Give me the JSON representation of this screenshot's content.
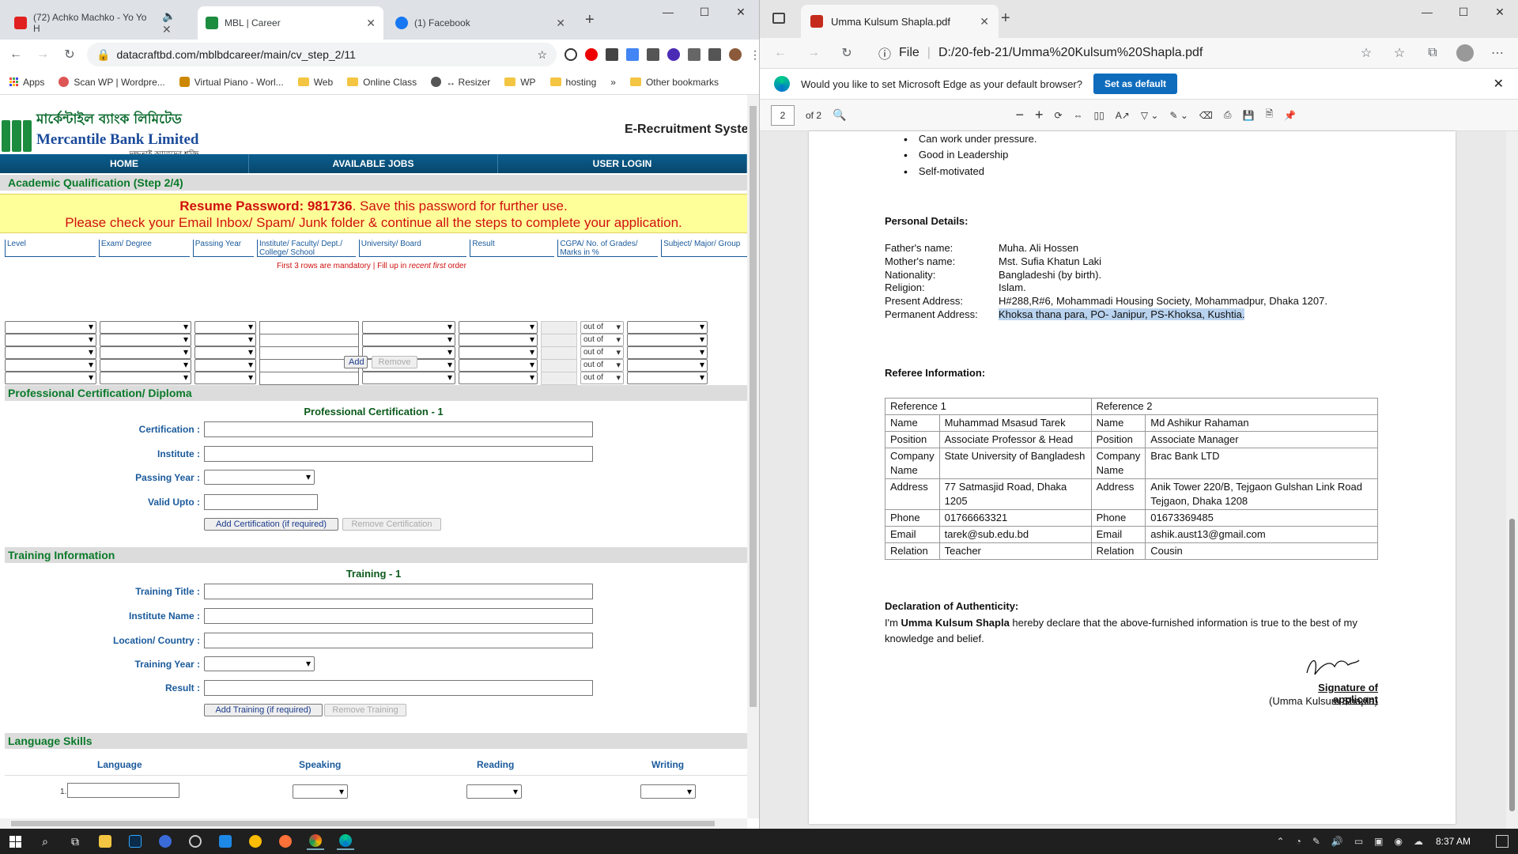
{
  "chrome": {
    "tabs": [
      {
        "title": "(72) Achko Machko - Yo Yo H",
        "color": "#e02020"
      },
      {
        "title": "MBL | Career",
        "color": "#1c8c3f"
      },
      {
        "title": "(1) Facebook",
        "color": "#1877f2"
      }
    ],
    "url": "datacraftbd.com/mblbdcareer/main/cv_step_2/11",
    "bookmarks": [
      "Apps",
      "Scan WP | Wordpre...",
      "Virtual Piano - Worl...",
      "Web",
      "Online Class",
      "↔ Resizer",
      "WP",
      "hosting",
      "»",
      "Other bookmarks"
    ]
  },
  "site": {
    "logo_bn": "মার্কেন্টাইল ব্যাংক লিমিটেড",
    "logo_en": "Mercantile Bank Limited",
    "logo_tag": "দক্ষতাই আমাদের শক্তি",
    "ers": "E-Recruitment Syste",
    "nav": [
      "HOME",
      "AVAILABLE JOBS",
      "USER LOGIN"
    ],
    "academic_header": "Academic Qualification (Step 2/4)",
    "pwd_prefix": "Resume Password: 981736",
    "pwd_suffix": ". Save this password for further use.",
    "pwd_line2": "Please check your Email Inbox/ Spam/ Junk folder & continue all the steps to complete your application.",
    "columns": [
      "Level",
      "Exam/ Degree",
      "Passing Year",
      "Institute/ Faculty/ Dept./ College/ School",
      "University/ Board",
      "Result",
      "CGPA/ No. of Grades/ Marks in %",
      "Subject/ Major/ Group"
    ],
    "note_a": "First 3 rows are mandatory | Fill up in ",
    "note_b": "recent first",
    "note_c": " order",
    "out_of": "out of",
    "add": "Add",
    "remove": "Remove",
    "cert_header": "Professional Certification/ Diploma",
    "cert_title": "Professional Certification - 1",
    "cert_labels": [
      "Certification :",
      "Institute :",
      "Passing Year :",
      "Valid Upto :"
    ],
    "add_cert": "Add Certification (if required)",
    "remove_cert": "Remove Certification",
    "train_header": "Training Information",
    "train_title": "Training - 1",
    "train_labels": [
      "Training Title :",
      "Institute Name :",
      "Location/ Country :",
      "Training Year :",
      "Result :"
    ],
    "add_train": "Add Training (if required)",
    "remove_train": "Remove Training",
    "lang_header": "Language Skills",
    "lang_cols": [
      "Language",
      "Speaking",
      "Reading",
      "Writing"
    ],
    "lang_row_num": "1."
  },
  "edge": {
    "tab_title": "Umma Kulsum Shapla.pdf",
    "file_label": "File",
    "url": "D:/20-feb-21/Umma%20Kulsum%20Shapla.pdf",
    "infobar_text": "Would you like to set Microsoft Edge as your default browser?",
    "set_default": "Set as default",
    "page_num": "2",
    "page_of": "of 2"
  },
  "pdf": {
    "bullets": [
      "Can work under pressure.",
      "Good in Leadership",
      "Self-motivated"
    ],
    "personal_title": "Personal Details:",
    "personal": [
      {
        "k": "Father's name:",
        "v": "Muha. Ali Hossen"
      },
      {
        "k": "Mother's name:",
        "v": "Mst. Sufia Khatun Laki"
      },
      {
        "k": "Nationality:",
        "v": "Bangladeshi (by birth)."
      },
      {
        "k": "Religion:",
        "v": "Islam."
      },
      {
        "k": "Present Address:",
        "v": "H#288,R#6, Mohammadi Housing Society, Mohammadpur, Dhaka 1207."
      },
      {
        "k": "Permanent Address:",
        "v": "Khoksa thana para, PO- Janipur, PS-Khoksa, Kushtia."
      }
    ],
    "referee_title": "Referee Information:",
    "ref_headers": [
      "Reference 1",
      "Reference 2"
    ],
    "ref_rows": [
      {
        "k1": "Name",
        "v1": "Muhammad Msasud Tarek",
        "k2": "Name",
        "v2": "Md Ashikur Rahaman"
      },
      {
        "k1": "Position",
        "v1": "Associate Professor & Head",
        "k2": "Position",
        "v2": "Associate Manager"
      },
      {
        "k1": "Company Name",
        "v1": "State University of Bangladesh",
        "k2": "Company Name",
        "v2": "Brac Bank LTD"
      },
      {
        "k1": "Address",
        "v1": "77 Satmasjid Road, Dhaka 1205",
        "k2": "Address",
        "v2": "Anik Tower 220/B, Tejgaon Gulshan Link Road Tejgaon, Dhaka 1208"
      },
      {
        "k1": "Phone",
        "v1": "01766663321",
        "k2": "Phone",
        "v2": "01673369485"
      },
      {
        "k1": "Email",
        "v1": "tarek@sub.edu.bd",
        "k2": "Email",
        "v2": "ashik.aust13@gmail.com"
      },
      {
        "k1": "Relation",
        "v1": "Teacher",
        "k2": "Relation",
        "v2": "Cousin"
      }
    ],
    "decl_title": "Declaration of Authenticity:",
    "decl_pre": "I'm ",
    "decl_name": "Umma Kulsum Shapla",
    "decl_post": " hereby declare that the above-furnished information is true to the best of my knowledge and belief.",
    "sig_label": "Signature of applicant",
    "sig_name": "(Umma Kulsum Shapla)"
  },
  "taskbar": {
    "time": "8:37 AM"
  }
}
